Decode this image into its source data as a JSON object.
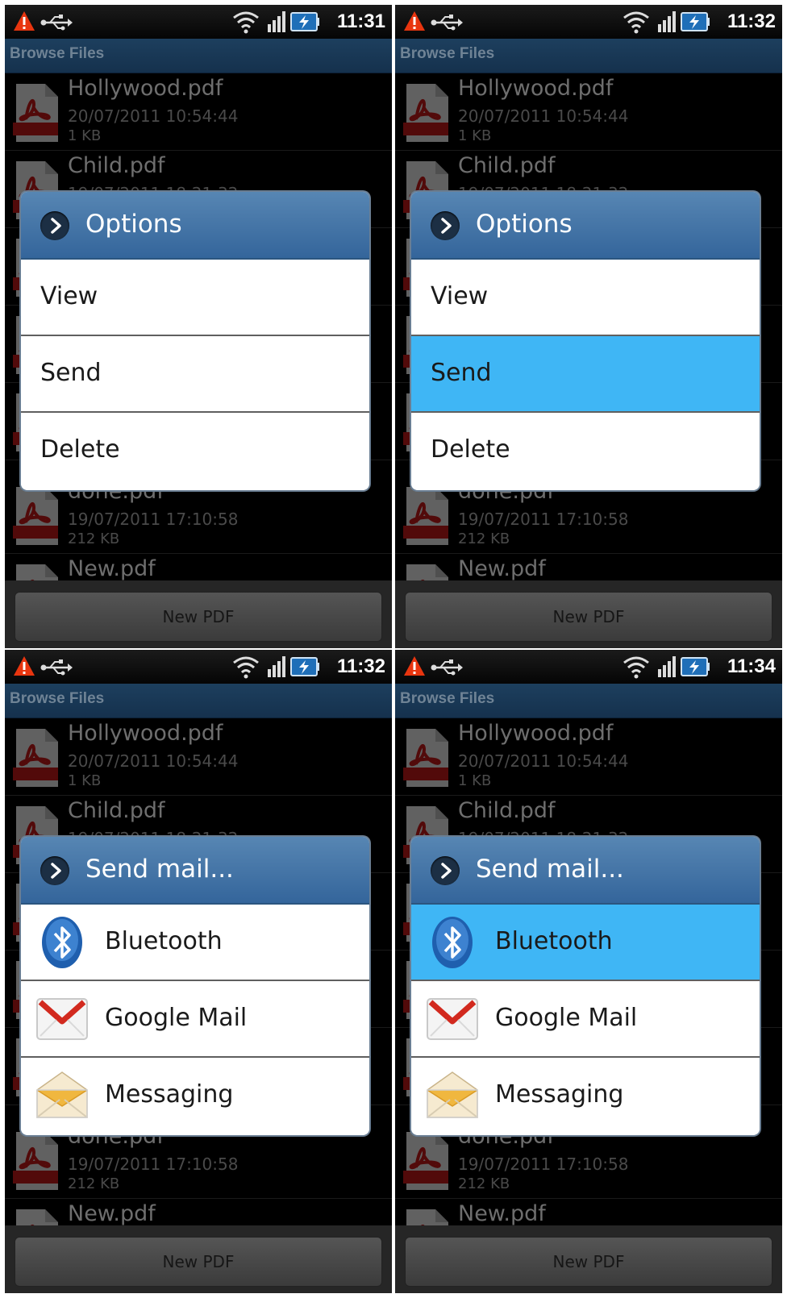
{
  "statusbar": {
    "times": [
      "11:31",
      "11:32",
      "11:32",
      "11:34"
    ]
  },
  "browser": {
    "title": "Browse Files",
    "files": [
      {
        "name": "Hollywood.pdf",
        "date": "20/07/2011 10:54:44",
        "size": "1 KB"
      },
      {
        "name": "Child.pdf",
        "date": "19/07/2011 18:21:32",
        "size": ""
      },
      {
        "name": "done.pdf",
        "date": "19/07/2011 17:10:58",
        "size": "212 KB"
      },
      {
        "name": "New.pdf",
        "date": "",
        "size": ""
      }
    ],
    "new_pdf_label": "New PDF"
  },
  "options_dialog": {
    "title": "Options",
    "items": [
      "View",
      "Send",
      "Delete"
    ]
  },
  "send_dialog": {
    "title": "Send mail...",
    "items": [
      {
        "label": "Bluetooth",
        "icon": "bluetooth-icon"
      },
      {
        "label": "Google Mail",
        "icon": "gmail-icon"
      },
      {
        "label": "Messaging",
        "icon": "messaging-icon"
      }
    ]
  },
  "colors": {
    "selection": "#3fb6f5",
    "dialog_header": "#4675a8",
    "titlebar": "#1a3a58"
  }
}
